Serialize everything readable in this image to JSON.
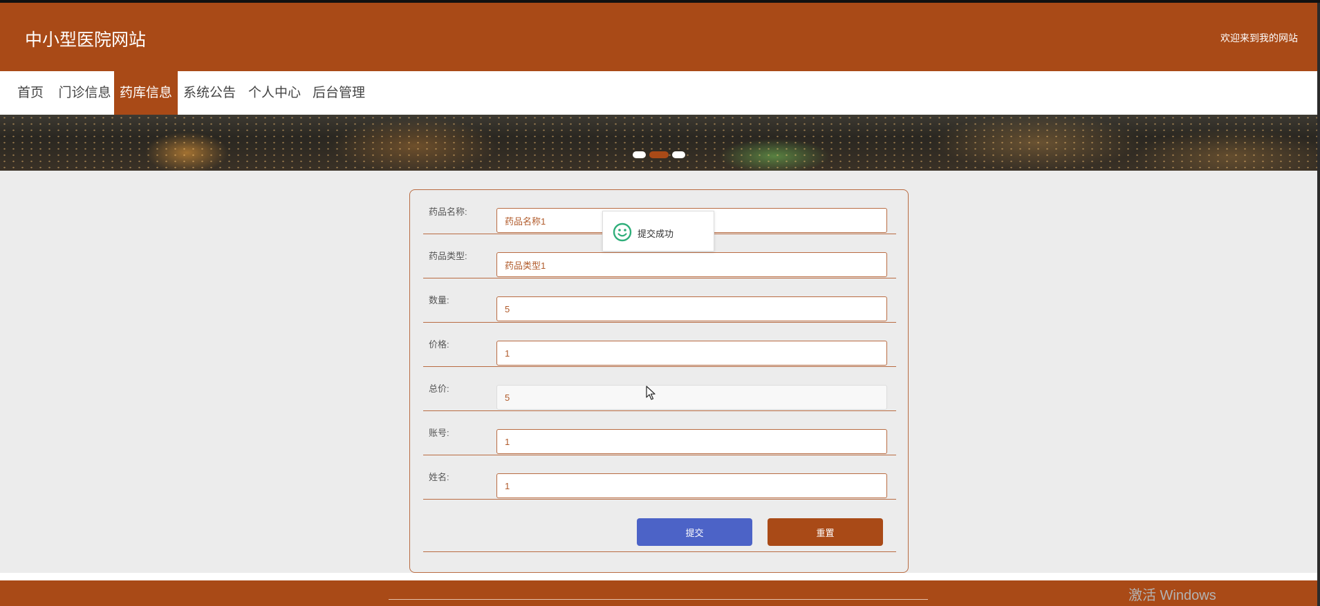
{
  "header": {
    "site_title": "中小型医院网站",
    "welcome": "欢迎来到我的网站",
    "bg_color": "#a94a17"
  },
  "nav": {
    "items": [
      {
        "label": "首页",
        "active": false
      },
      {
        "label": "门诊信息",
        "active": false
      },
      {
        "label": "药库信息",
        "active": true
      },
      {
        "label": "系统公告",
        "active": false
      },
      {
        "label": "个人中心",
        "active": false
      },
      {
        "label": "后台管理",
        "active": false
      }
    ]
  },
  "banner": {
    "slide_count": 3,
    "active_slide": 2
  },
  "form": {
    "fields": [
      {
        "label": "药品名称:",
        "value": "药品名称1",
        "readonly": false
      },
      {
        "label": "药品类型:",
        "value": "药品类型1",
        "readonly": false
      },
      {
        "label": "数量:",
        "value": "5",
        "readonly": false
      },
      {
        "label": "价格:",
        "value": "1",
        "readonly": false
      },
      {
        "label": "总价:",
        "value": "5",
        "readonly": true
      },
      {
        "label": "账号:",
        "value": "1",
        "readonly": false
      },
      {
        "label": "姓名:",
        "value": "1",
        "readonly": false
      }
    ],
    "submit_label": "提交",
    "reset_label": "重置",
    "submit_color": "#4c63c7",
    "reset_color": "#a94a17"
  },
  "toast": {
    "icon": "smile-icon",
    "text": "提交成功"
  },
  "watermark": {
    "text": "激活 Windows"
  }
}
